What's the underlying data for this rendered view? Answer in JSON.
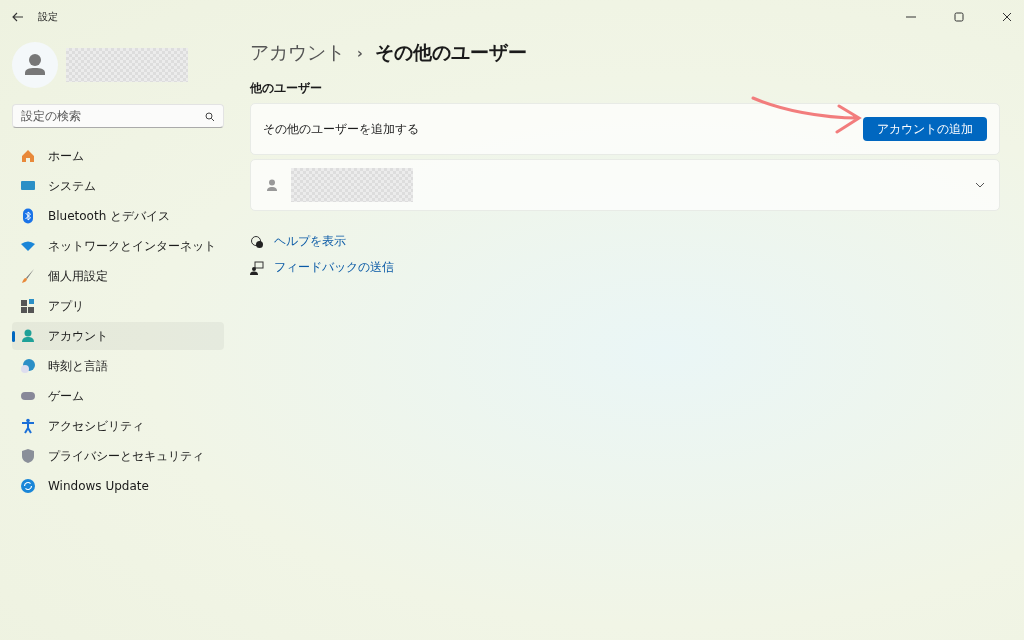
{
  "window": {
    "title": "設定"
  },
  "search": {
    "placeholder": "設定の検索"
  },
  "sidebar": {
    "items": [
      {
        "label": "ホーム",
        "selected": false
      },
      {
        "label": "システム",
        "selected": false
      },
      {
        "label": "Bluetooth とデバイス",
        "selected": false
      },
      {
        "label": "ネットワークとインターネット",
        "selected": false
      },
      {
        "label": "個人用設定",
        "selected": false
      },
      {
        "label": "アプリ",
        "selected": false
      },
      {
        "label": "アカウント",
        "selected": true
      },
      {
        "label": "時刻と言語",
        "selected": false
      },
      {
        "label": "ゲーム",
        "selected": false
      },
      {
        "label": "アクセシビリティ",
        "selected": false
      },
      {
        "label": "プライバシーとセキュリティ",
        "selected": false
      },
      {
        "label": "Windows Update",
        "selected": false
      }
    ]
  },
  "breadcrumb": {
    "parent": "アカウント",
    "separator": "›",
    "current": "その他のユーザー"
  },
  "section_title": "他のユーザー",
  "add_user": {
    "label": "その他のユーザーを追加する",
    "button": "アカウントの追加"
  },
  "links": [
    "ヘルプを表示",
    "フィードバックの送信"
  ]
}
